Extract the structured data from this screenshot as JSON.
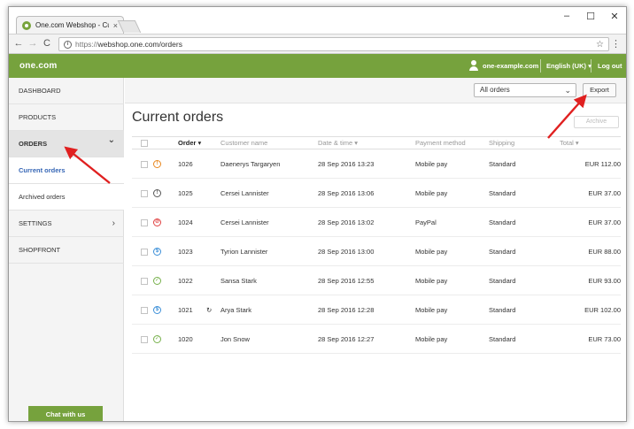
{
  "browser": {
    "tab_title": "One.com Webshop - Cur",
    "tab_close": "×",
    "url_scheme": "https://",
    "url_rest": "webshop.one.com/orders",
    "nav_back": "←",
    "nav_forward": "→",
    "nav_reload": "C",
    "star": "☆",
    "menu": "⋮",
    "win_min": "–",
    "win_max": "☐",
    "win_close": "✕"
  },
  "header": {
    "logo": "one.com",
    "user": "one-example.com",
    "language": "English (UK) ▾",
    "logout": "Log out"
  },
  "sidebar": {
    "items": [
      {
        "label": "DASHBOARD"
      },
      {
        "label": "PRODUCTS"
      },
      {
        "label": "ORDERS",
        "chevron": "⌄"
      },
      {
        "label": "Current orders"
      },
      {
        "label": "Archived orders"
      },
      {
        "label": "SETTINGS",
        "chevron": "›"
      },
      {
        "label": "SHOPFRONT"
      }
    ],
    "chat_label": "Chat with us"
  },
  "main": {
    "filter_value": "All orders",
    "filter_chevron": "⌄",
    "export_label": "Export",
    "title": "Current orders",
    "archive_label": "Archive",
    "columns": {
      "order": "Order ▾",
      "customer": "Customer name",
      "date": "Date & time ▾",
      "payment": "Payment method",
      "shipping": "Shipping",
      "total": "Total ▾"
    },
    "rows": [
      {
        "status_glyph": "!",
        "status_color": "#e8871e",
        "order": "1026",
        "note": "",
        "customer": "Daenerys Targaryen",
        "date": "28 Sep 2016 13:23",
        "payment": "Mobile pay",
        "shipping": "Standard",
        "total": "EUR 112.00"
      },
      {
        "status_glyph": "!",
        "status_color": "#555555",
        "order": "1025",
        "note": "",
        "customer": "Cersei Lannister",
        "date": "28 Sep 2016 13:06",
        "payment": "Mobile pay",
        "shipping": "Standard",
        "total": "EUR 37.00"
      },
      {
        "status_glyph": "⊘",
        "status_color": "#e04040",
        "order": "1024",
        "note": "",
        "customer": "Cersei Lannister",
        "date": "28 Sep 2016 13:02",
        "payment": "PayPal",
        "shipping": "Standard",
        "total": "EUR 37.00"
      },
      {
        "status_glyph": "$",
        "status_color": "#3b8fd8",
        "order": "1023",
        "note": "",
        "customer": "Tyrion Lannister",
        "date": "28 Sep 2016 13:00",
        "payment": "Mobile pay",
        "shipping": "Standard",
        "total": "EUR 88.00"
      },
      {
        "status_glyph": "✓",
        "status_color": "#76b04a",
        "order": "1022",
        "note": "",
        "customer": "Sansa Stark",
        "date": "28 Sep 2016 12:55",
        "payment": "Mobile pay",
        "shipping": "Standard",
        "total": "EUR 93.00"
      },
      {
        "status_glyph": "$",
        "status_color": "#3b8fd8",
        "order": "1021",
        "note": "↻",
        "customer": "Arya Stark",
        "date": "28 Sep 2016 12:28",
        "payment": "Mobile pay",
        "shipping": "Standard",
        "total": "EUR 102.00"
      },
      {
        "status_glyph": "✓",
        "status_color": "#76b04a",
        "order": "1020",
        "note": "",
        "customer": "Jon Snow",
        "date": "28 Sep 2016 12:27",
        "payment": "Mobile pay",
        "shipping": "Standard",
        "total": "EUR 73.00"
      }
    ]
  },
  "colors": {
    "brand_green": "#76a23d",
    "annotation_red": "#e02020",
    "active_link": "#3565b5"
  }
}
